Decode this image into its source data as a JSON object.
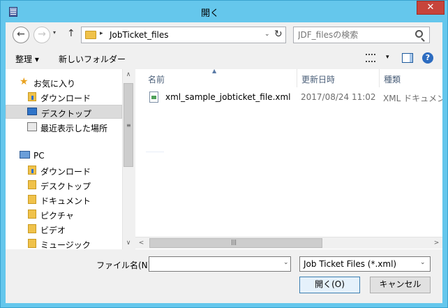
{
  "window": {
    "title": "開く",
    "close_glyph": "✕"
  },
  "nav": {
    "back_glyph": "←",
    "forward_glyph": "→",
    "recent_glyph": "▾",
    "up_glyph": "↑"
  },
  "address": {
    "separator_glyph": "▸",
    "path": "JobTicket_files",
    "dropdown_glyph": "⌄",
    "refresh_glyph": "↻"
  },
  "search": {
    "placeholder": "JDF_filesの検索"
  },
  "toolbar": {
    "organize": "整理 ▾",
    "new_folder": "新しいフォルダー",
    "view_dropdown_glyph": "▾",
    "help_glyph": "?"
  },
  "sidebar": {
    "items": [
      {
        "label": "お気に入り",
        "icon": "star-icon"
      },
      {
        "label": "ダウンロード",
        "icon": "downloads-folder-icon"
      },
      {
        "label": "デスクトップ",
        "icon": "desktop-icon",
        "selected": true
      },
      {
        "label": "最近表示した場所",
        "icon": "recent-places-icon"
      },
      {
        "label": "PC",
        "icon": "pc-icon"
      },
      {
        "label": "ダウンロード",
        "icon": "downloads-folder-icon"
      },
      {
        "label": "デスクトップ",
        "icon": "desktop-folder-icon"
      },
      {
        "label": "ドキュメント",
        "icon": "documents-folder-icon"
      },
      {
        "label": "ピクチャ",
        "icon": "pictures-folder-icon"
      },
      {
        "label": "ビデオ",
        "icon": "videos-folder-icon"
      },
      {
        "label": "ミュージック",
        "icon": "music-folder-icon"
      }
    ]
  },
  "scroll": {
    "up": "∧",
    "down": "∨",
    "left": "<",
    "right": ">",
    "grip_v": "≡",
    "grip_h": "|||"
  },
  "filelist": {
    "sort_glyph": "▲",
    "columns": [
      "名前",
      "更新日時",
      "種類"
    ],
    "rows": [
      {
        "name": "xml_sample_jobticket_file.xml",
        "modified": "2017/08/24 11:02",
        "type": "XML ドキュメント"
      }
    ]
  },
  "footer": {
    "filename_label": "ファイル名(N):",
    "filename_value": "",
    "filename_dropdown_glyph": "⌄",
    "filter": "Job Ticket Files (*.xml)",
    "filter_dropdown_glyph": "⌄",
    "open_button": "開く(O)",
    "cancel_button": "キャンセル"
  },
  "colors": {
    "title_bar": "#65c7ec",
    "close_button": "#c7443b",
    "folder": "#f0c24a",
    "selection": "#dbdbdb"
  }
}
